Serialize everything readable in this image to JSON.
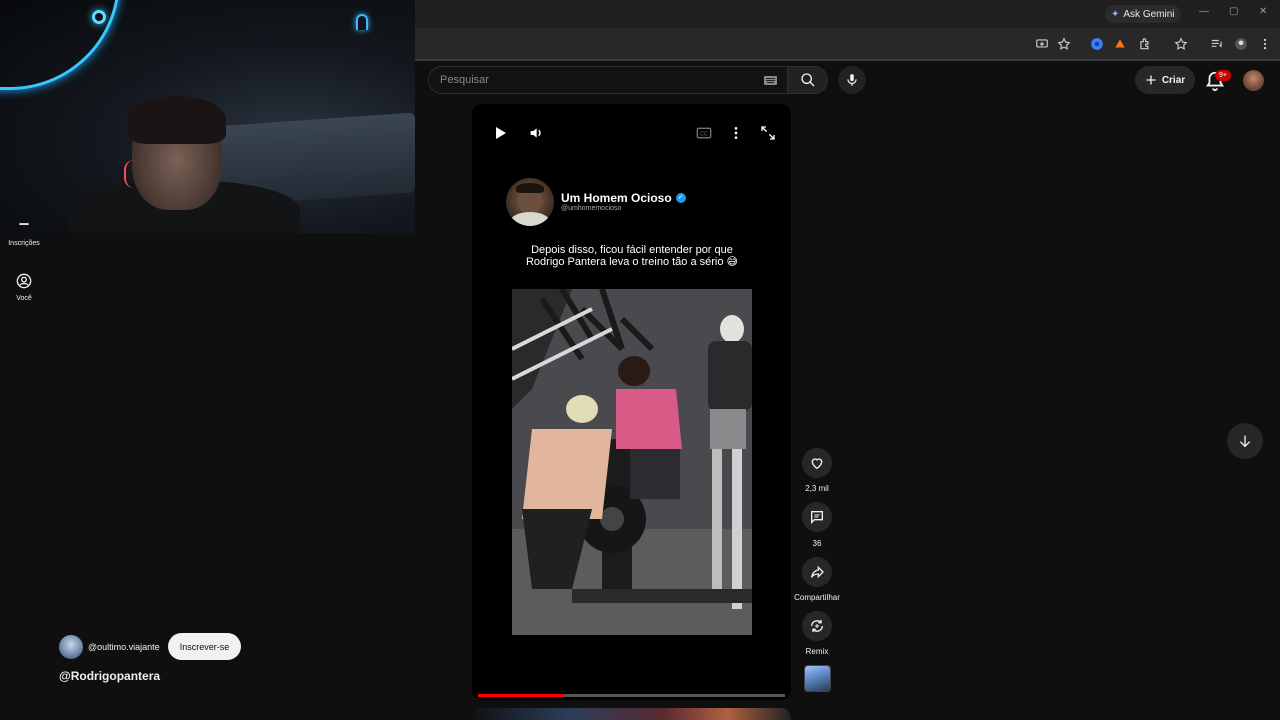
{
  "browser": {
    "ask_gemini_label": "Ask Gemini",
    "window_controls": [
      "—",
      "▢",
      "✕"
    ]
  },
  "sidebar": {
    "items": [
      {
        "label": "Inscrições",
        "icon": "subscriptions-icon"
      },
      {
        "label": "Você",
        "icon": "account-icon"
      }
    ]
  },
  "header": {
    "search_placeholder": "Pesquisar",
    "create_label": "Criar",
    "notifications_badge": "9+"
  },
  "short": {
    "post": {
      "author_name": "Um Homem Ocioso",
      "author_handle": "@umhomemocioso",
      "caption_line1": "Depois disso, ficou fácil entender por que",
      "caption_line2": "Rodrigo Pantera leva o treino tão a sério 😅"
    },
    "progress": 0.28,
    "actions": {
      "like_count": "2,3 mil",
      "comment_count": "36",
      "share_label": "Compartilhar",
      "remix_label": "Remix"
    }
  },
  "channel": {
    "handle": "@oultimo.viajante",
    "subscribe_label": "Inscrever-se",
    "title": "@Rodrigopantera"
  },
  "colors": {
    "background": "#0f0f0f",
    "accent_red": "#ff0000",
    "verified_blue": "#1d9bf0"
  }
}
